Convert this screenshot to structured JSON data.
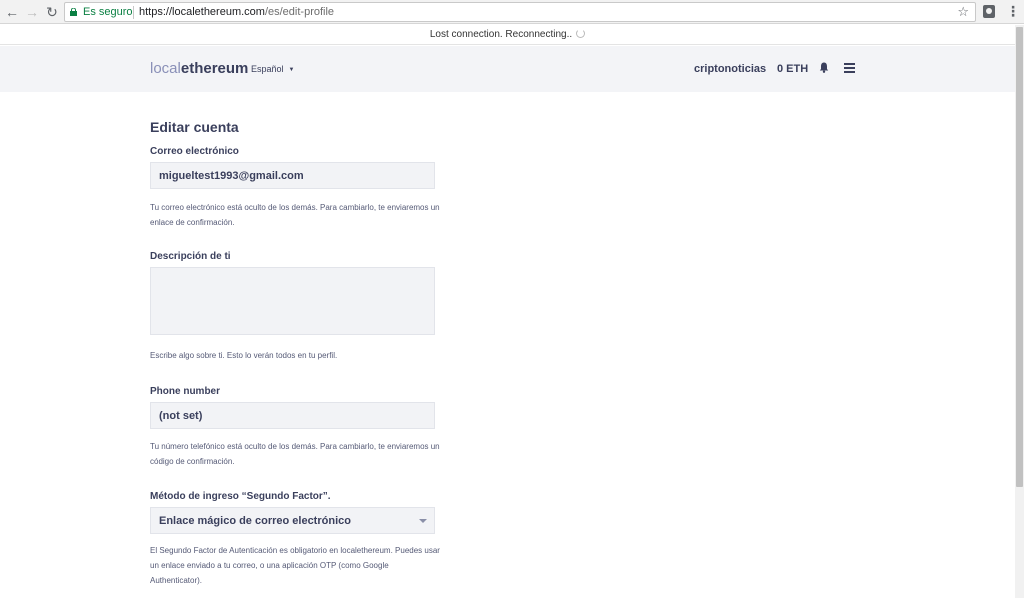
{
  "browser": {
    "secure_label": "Es seguro",
    "url_host": "https://localethereum.com",
    "url_path": "/es/edit-profile"
  },
  "status_bar": {
    "text": "Lost connection. Reconnecting.."
  },
  "header": {
    "logo_local": "local",
    "logo_eth": "ethereum",
    "language": "Español",
    "username": "criptonoticias",
    "balance": "0 ETH"
  },
  "form": {
    "title": "Editar cuenta",
    "email": {
      "label": "Correo electrónico",
      "value": "migueltest1993@gmail.com",
      "help": "Tu correo electrónico está oculto de los demás. Para cambiarlo, te enviaremos un enlace de confirmación."
    },
    "description": {
      "label": "Descripción de ti",
      "value": "",
      "help": "Escribe algo sobre ti. Esto lo verán todos en tu perfil."
    },
    "phone": {
      "label": "Phone number",
      "value": "(not set)",
      "help": "Tu número telefónico está oculto de los demás. Para cambiarlo, te enviaremos un código de confirmación."
    },
    "two_factor": {
      "label": "Método de ingreso “Segundo Factor”.",
      "selected": "Enlace mágico de correo electrónico",
      "help": "El Segundo Factor de Autenticación es obligatorio en localethereum. Puedes usar un enlace enviado a tu correo, o una aplicación OTP (como Google Authenticator)."
    }
  }
}
